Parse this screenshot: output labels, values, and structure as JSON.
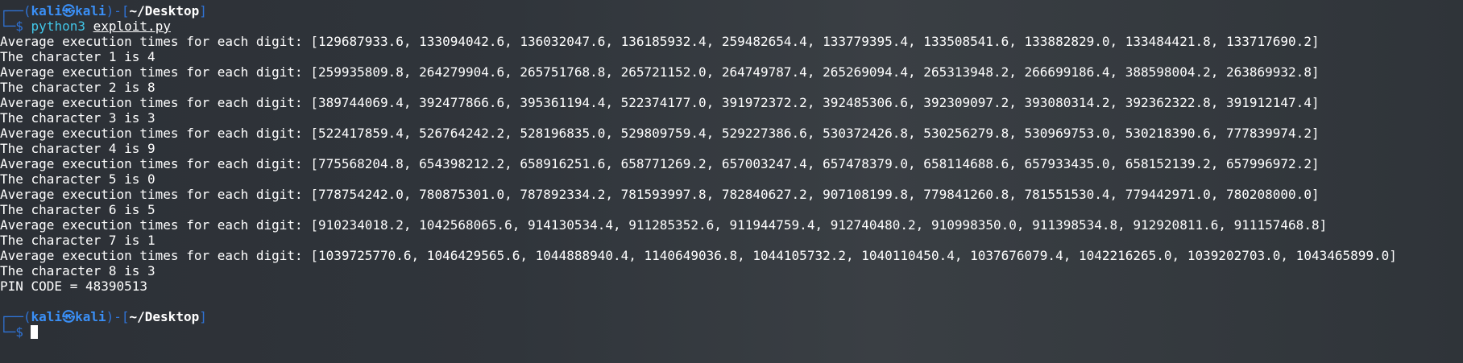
{
  "prompt": {
    "frame_top_left": "┌──(",
    "user": "kali",
    "at_symbol": "㉿",
    "host": "kali",
    "frame_mid": ")-[",
    "path": "~/Desktop",
    "frame_end": "]",
    "frame_bottom": "└─",
    "dollar": "$"
  },
  "command": {
    "program": "python3",
    "arg": "exploit.py"
  },
  "output_lines": [
    "Average execution times for each digit: [129687933.6, 133094042.6, 136032047.6, 136185932.4, 259482654.4, 133779395.4, 133508541.6, 133882829.0, 133484421.8, 133717690.2]",
    "The character 1 is 4",
    "Average execution times for each digit: [259935809.8, 264279904.6, 265751768.8, 265721152.0, 264749787.4, 265269094.4, 265313948.2, 266699186.4, 388598004.2, 263869932.8]",
    "The character 2 is 8",
    "Average execution times for each digit: [389744069.4, 392477866.6, 395361194.4, 522374177.0, 391972372.2, 392485306.6, 392309097.2, 393080314.2, 392362322.8, 391912147.4]",
    "The character 3 is 3",
    "Average execution times for each digit: [522417859.4, 526764242.2, 528196835.0, 529809759.4, 529227386.6, 530372426.8, 530256279.8, 530969753.0, 530218390.6, 777839974.2]",
    "The character 4 is 9",
    "Average execution times for each digit: [775568204.8, 654398212.2, 658916251.6, 658771269.2, 657003247.4, 657478379.0, 658114688.6, 657933435.0, 658152139.2, 657996972.2]",
    "The character 5 is 0",
    "Average execution times for each digit: [778754242.0, 780875301.0, 787892334.2, 781593997.8, 782840627.2, 907108199.8, 779841260.8, 781551530.4, 779442971.0, 780208000.0]",
    "The character 6 is 5",
    "Average execution times for each digit: [910234018.2, 1042568065.6, 914130534.4, 911285352.6, 911944759.4, 912740480.2, 910998350.0, 911398534.8, 912920811.6, 911157468.8]",
    "The character 7 is 1",
    "Average execution times for each digit: [1039725770.6, 1046429565.6, 1044888940.4, 1140649036.8, 1044105732.2, 1040110450.4, 1037676079.4, 1042216265.0, 1039202703.0, 1043465899.0]",
    "The character 8 is 3",
    "PIN CODE = 48390513"
  ],
  "colors": {
    "prompt_frame": "#2f73d6",
    "prompt_user": "#3a8ff6",
    "command": "#41c6e8",
    "text": "#ffffff"
  }
}
